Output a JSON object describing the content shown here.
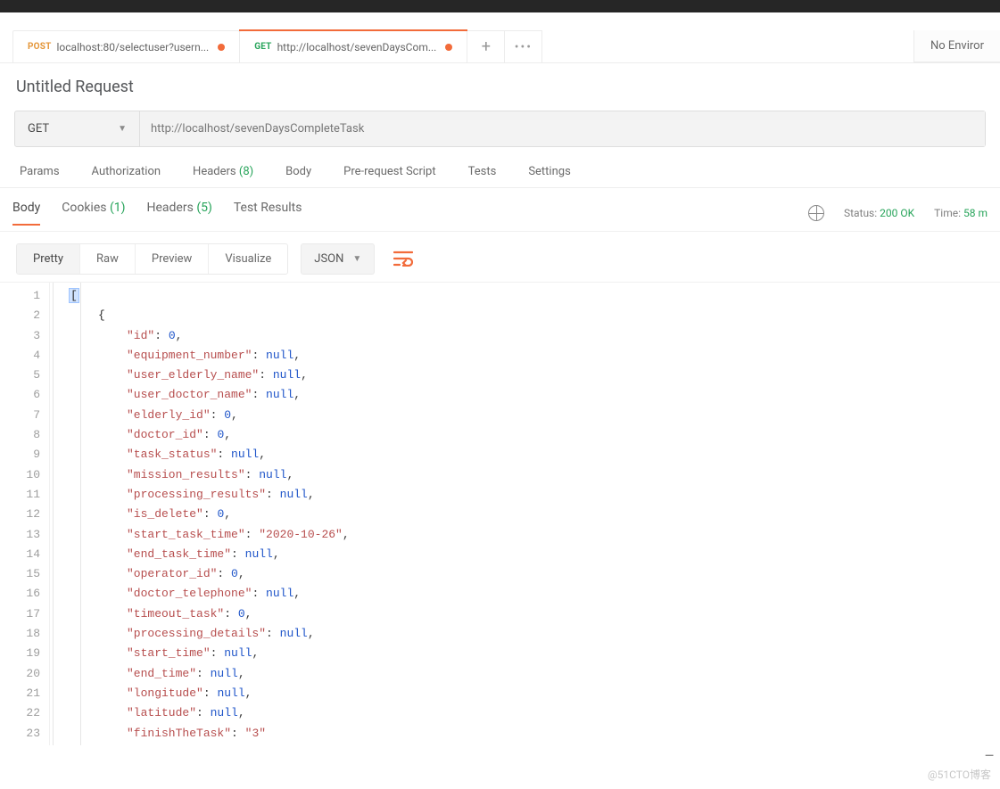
{
  "env": {
    "label": "No Enviror"
  },
  "tabs": [
    {
      "method": "POST",
      "title": "localhost:80/selectuser?usern...",
      "dirty": true,
      "active": false
    },
    {
      "method": "GET",
      "title": "http://localhost/sevenDaysCom...",
      "dirty": true,
      "active": true
    }
  ],
  "request": {
    "title": "Untitled Request",
    "method_selected": "GET",
    "url": "http://localhost/sevenDaysCompleteTask"
  },
  "req_subtabs": {
    "params": "Params",
    "authorization": "Authorization",
    "headers_label": "Headers",
    "headers_count": "(8)",
    "body": "Body",
    "prerequest": "Pre-request Script",
    "tests": "Tests",
    "settings": "Settings"
  },
  "resp_tabs": {
    "body": "Body",
    "cookies_label": "Cookies",
    "cookies_count": "(1)",
    "headers_label": "Headers",
    "headers_count": "(5)",
    "test_results": "Test Results"
  },
  "resp_meta": {
    "status_label": "Status:",
    "status_value": "200 OK",
    "time_label": "Time:",
    "time_value": "58 m"
  },
  "body_controls": {
    "pretty": "Pretty",
    "raw": "Raw",
    "preview": "Preview",
    "visualize": "Visualize",
    "format": "JSON"
  },
  "code_lines": [
    {
      "n": 1,
      "indent": 0,
      "tokens": [
        {
          "t": "sel",
          "v": "["
        }
      ]
    },
    {
      "n": 2,
      "indent": 1,
      "tokens": [
        {
          "t": "br",
          "v": "{"
        }
      ]
    },
    {
      "n": 3,
      "indent": 2,
      "tokens": [
        {
          "t": "key",
          "v": "\"id\""
        },
        {
          "t": "punc",
          "v": ": "
        },
        {
          "t": "num",
          "v": "0"
        },
        {
          "t": "punc",
          "v": ","
        }
      ]
    },
    {
      "n": 4,
      "indent": 2,
      "tokens": [
        {
          "t": "key",
          "v": "\"equipment_number\""
        },
        {
          "t": "punc",
          "v": ": "
        },
        {
          "t": "null",
          "v": "null"
        },
        {
          "t": "punc",
          "v": ","
        }
      ]
    },
    {
      "n": 5,
      "indent": 2,
      "tokens": [
        {
          "t": "key",
          "v": "\"user_elderly_name\""
        },
        {
          "t": "punc",
          "v": ": "
        },
        {
          "t": "null",
          "v": "null"
        },
        {
          "t": "punc",
          "v": ","
        }
      ]
    },
    {
      "n": 6,
      "indent": 2,
      "tokens": [
        {
          "t": "key",
          "v": "\"user_doctor_name\""
        },
        {
          "t": "punc",
          "v": ": "
        },
        {
          "t": "null",
          "v": "null"
        },
        {
          "t": "punc",
          "v": ","
        }
      ]
    },
    {
      "n": 7,
      "indent": 2,
      "tokens": [
        {
          "t": "key",
          "v": "\"elderly_id\""
        },
        {
          "t": "punc",
          "v": ": "
        },
        {
          "t": "num",
          "v": "0"
        },
        {
          "t": "punc",
          "v": ","
        }
      ]
    },
    {
      "n": 8,
      "indent": 2,
      "tokens": [
        {
          "t": "key",
          "v": "\"doctor_id\""
        },
        {
          "t": "punc",
          "v": ": "
        },
        {
          "t": "num",
          "v": "0"
        },
        {
          "t": "punc",
          "v": ","
        }
      ]
    },
    {
      "n": 9,
      "indent": 2,
      "tokens": [
        {
          "t": "key",
          "v": "\"task_status\""
        },
        {
          "t": "punc",
          "v": ": "
        },
        {
          "t": "null",
          "v": "null"
        },
        {
          "t": "punc",
          "v": ","
        }
      ]
    },
    {
      "n": 10,
      "indent": 2,
      "tokens": [
        {
          "t": "key",
          "v": "\"mission_results\""
        },
        {
          "t": "punc",
          "v": ": "
        },
        {
          "t": "null",
          "v": "null"
        },
        {
          "t": "punc",
          "v": ","
        }
      ]
    },
    {
      "n": 11,
      "indent": 2,
      "tokens": [
        {
          "t": "key",
          "v": "\"processing_results\""
        },
        {
          "t": "punc",
          "v": ": "
        },
        {
          "t": "null",
          "v": "null"
        },
        {
          "t": "punc",
          "v": ","
        }
      ]
    },
    {
      "n": 12,
      "indent": 2,
      "tokens": [
        {
          "t": "key",
          "v": "\"is_delete\""
        },
        {
          "t": "punc",
          "v": ": "
        },
        {
          "t": "num",
          "v": "0"
        },
        {
          "t": "punc",
          "v": ","
        }
      ]
    },
    {
      "n": 13,
      "indent": 2,
      "tokens": [
        {
          "t": "key",
          "v": "\"start_task_time\""
        },
        {
          "t": "punc",
          "v": ": "
        },
        {
          "t": "str",
          "v": "\"2020-10-26\""
        },
        {
          "t": "punc",
          "v": ","
        }
      ]
    },
    {
      "n": 14,
      "indent": 2,
      "tokens": [
        {
          "t": "key",
          "v": "\"end_task_time\""
        },
        {
          "t": "punc",
          "v": ": "
        },
        {
          "t": "null",
          "v": "null"
        },
        {
          "t": "punc",
          "v": ","
        }
      ]
    },
    {
      "n": 15,
      "indent": 2,
      "tokens": [
        {
          "t": "key",
          "v": "\"operator_id\""
        },
        {
          "t": "punc",
          "v": ": "
        },
        {
          "t": "num",
          "v": "0"
        },
        {
          "t": "punc",
          "v": ","
        }
      ]
    },
    {
      "n": 16,
      "indent": 2,
      "tokens": [
        {
          "t": "key",
          "v": "\"doctor_telephone\""
        },
        {
          "t": "punc",
          "v": ": "
        },
        {
          "t": "null",
          "v": "null"
        },
        {
          "t": "punc",
          "v": ","
        }
      ]
    },
    {
      "n": 17,
      "indent": 2,
      "tokens": [
        {
          "t": "key",
          "v": "\"timeout_task\""
        },
        {
          "t": "punc",
          "v": ": "
        },
        {
          "t": "num",
          "v": "0"
        },
        {
          "t": "punc",
          "v": ","
        }
      ]
    },
    {
      "n": 18,
      "indent": 2,
      "tokens": [
        {
          "t": "key",
          "v": "\"processing_details\""
        },
        {
          "t": "punc",
          "v": ": "
        },
        {
          "t": "null",
          "v": "null"
        },
        {
          "t": "punc",
          "v": ","
        }
      ]
    },
    {
      "n": 19,
      "indent": 2,
      "tokens": [
        {
          "t": "key",
          "v": "\"start_time\""
        },
        {
          "t": "punc",
          "v": ": "
        },
        {
          "t": "null",
          "v": "null"
        },
        {
          "t": "punc",
          "v": ","
        }
      ]
    },
    {
      "n": 20,
      "indent": 2,
      "tokens": [
        {
          "t": "key",
          "v": "\"end_time\""
        },
        {
          "t": "punc",
          "v": ": "
        },
        {
          "t": "null",
          "v": "null"
        },
        {
          "t": "punc",
          "v": ","
        }
      ]
    },
    {
      "n": 21,
      "indent": 2,
      "tokens": [
        {
          "t": "key",
          "v": "\"longitude\""
        },
        {
          "t": "punc",
          "v": ": "
        },
        {
          "t": "null",
          "v": "null"
        },
        {
          "t": "punc",
          "v": ","
        }
      ]
    },
    {
      "n": 22,
      "indent": 2,
      "tokens": [
        {
          "t": "key",
          "v": "\"latitude\""
        },
        {
          "t": "punc",
          "v": ": "
        },
        {
          "t": "null",
          "v": "null"
        },
        {
          "t": "punc",
          "v": ","
        }
      ]
    },
    {
      "n": 23,
      "indent": 2,
      "tokens": [
        {
          "t": "key",
          "v": "\"finishTheTask\""
        },
        {
          "t": "punc",
          "v": ": "
        },
        {
          "t": "str",
          "v": "\"3\""
        }
      ]
    }
  ],
  "watermark": "@51CTO博客"
}
